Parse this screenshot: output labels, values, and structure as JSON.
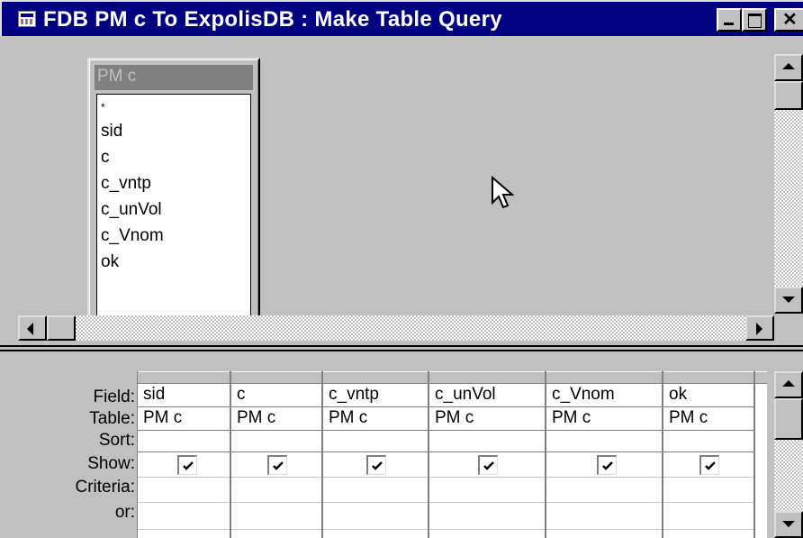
{
  "window": {
    "title": "FDB PM c To ExpolisDB : Make Table Query",
    "icon": "query-icon",
    "controls": [
      "minimize",
      "maximize",
      "close"
    ]
  },
  "table_box": {
    "title": "PM c",
    "fields": [
      "*",
      "sid",
      "c",
      "c_vntp",
      "c_unVol",
      "c_Vnom",
      "ok"
    ]
  },
  "grid": {
    "row_labels": [
      "Field:",
      "Table:",
      "Sort:",
      "Show:",
      "Criteria:",
      "or:"
    ],
    "columns": [
      {
        "field": "sid",
        "table": "PM c",
        "sort": "",
        "show": true
      },
      {
        "field": "c",
        "table": "PM c",
        "sort": "",
        "show": true
      },
      {
        "field": "c_vntp",
        "table": "PM c",
        "sort": "",
        "show": true
      },
      {
        "field": "c_unVol",
        "table": "PM c",
        "sort": "",
        "show": true
      },
      {
        "field": "c_Vnom",
        "table": "PM c",
        "sort": "",
        "show": true
      },
      {
        "field": "ok",
        "table": "PM c",
        "sort": "",
        "show": true
      }
    ]
  },
  "colors": {
    "title_bar": "#000080",
    "face": "#c0c0c0",
    "grid_background": "#ffffff"
  }
}
